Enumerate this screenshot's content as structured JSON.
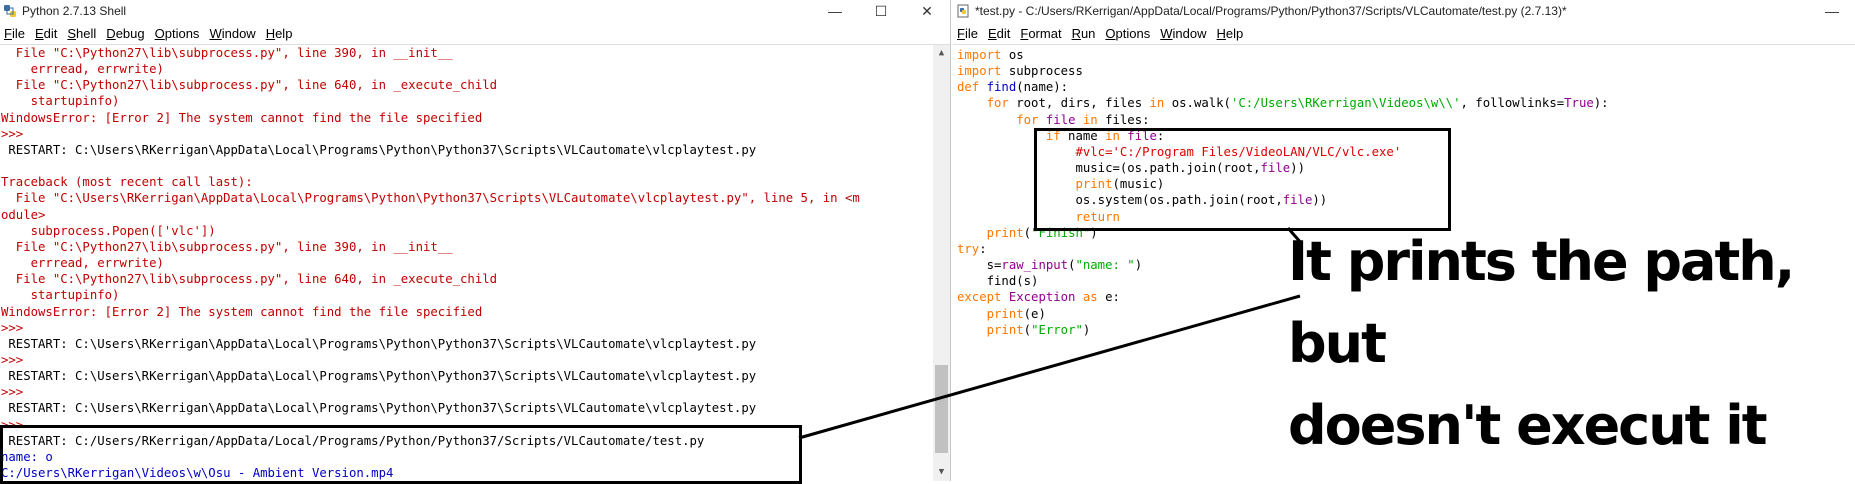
{
  "shell": {
    "title": "Python 2.7.13 Shell",
    "menu": [
      "File",
      "Edit",
      "Shell",
      "Debug",
      "Options",
      "Window",
      "Help"
    ],
    "lines": [
      {
        "t": "  File \"C:\\Python27\\lib\\subprocess.py\", line 390, in __init__",
        "c": "red"
      },
      {
        "t": "    errread, errwrite)",
        "c": "red"
      },
      {
        "t": "  File \"C:\\Python27\\lib\\subprocess.py\", line 640, in _execute_child",
        "c": "red"
      },
      {
        "t": "    startupinfo)",
        "c": "red"
      },
      {
        "t": "WindowsError: [Error 2] The system cannot find the file specified",
        "c": "red"
      },
      {
        "t": ">>> ",
        "c": "red"
      },
      {
        "t": " RESTART: C:\\Users\\RKerrigan\\AppData\\Local\\Programs\\Python\\Python37\\Scripts\\VLCautomate\\vlcplaytest.py",
        "c": "blk"
      },
      {
        "t": "",
        "c": "blk"
      },
      {
        "t": "Traceback (most recent call last):",
        "c": "red"
      },
      {
        "t": "  File \"C:\\Users\\RKerrigan\\AppData\\Local\\Programs\\Python\\Python37\\Scripts\\VLCautomate\\vlcplaytest.py\", line 5, in <m",
        "c": "red"
      },
      {
        "t": "odule>",
        "c": "red"
      },
      {
        "t": "    subprocess.Popen(['vlc'])",
        "c": "red"
      },
      {
        "t": "  File \"C:\\Python27\\lib\\subprocess.py\", line 390, in __init__",
        "c": "red"
      },
      {
        "t": "    errread, errwrite)",
        "c": "red"
      },
      {
        "t": "  File \"C:\\Python27\\lib\\subprocess.py\", line 640, in _execute_child",
        "c": "red"
      },
      {
        "t": "    startupinfo)",
        "c": "red"
      },
      {
        "t": "WindowsError: [Error 2] The system cannot find the file specified",
        "c": "red"
      },
      {
        "t": ">>> ",
        "c": "red"
      },
      {
        "t": " RESTART: C:\\Users\\RKerrigan\\AppData\\Local\\Programs\\Python\\Python37\\Scripts\\VLCautomate\\vlcplaytest.py",
        "c": "blk"
      },
      {
        "t": ">>> ",
        "c": "red"
      },
      {
        "t": " RESTART: C:\\Users\\RKerrigan\\AppData\\Local\\Programs\\Python\\Python37\\Scripts\\VLCautomate\\vlcplaytest.py",
        "c": "blk"
      },
      {
        "t": ">>> ",
        "c": "red"
      },
      {
        "t": " RESTART: C:\\Users\\RKerrigan\\AppData\\Local\\Programs\\Python\\Python37\\Scripts\\VLCautomate\\vlcplaytest.py",
        "c": "blk"
      },
      {
        "t": ">>> ",
        "c": "red"
      },
      {
        "t": " RESTART: C:/Users/RKerrigan/AppData/Local/Programs/Python/Python37/Scripts/VLCautomate/test.py",
        "c": "blk"
      },
      {
        "t": "name: o",
        "c": "blu"
      },
      {
        "t": "C:/Users\\RKerrigan\\Videos\\w\\Osu - Ambient Version.mp4",
        "c": "blu"
      }
    ]
  },
  "editor": {
    "title": "*test.py - C:/Users/RKerrigan/AppData/Local/Programs/Python/Python37/Scripts/VLCautomate/test.py (2.7.13)*",
    "menu": [
      "File",
      "Edit",
      "Format",
      "Run",
      "Options",
      "Window",
      "Help"
    ],
    "lines": [
      [
        {
          "t": "import",
          "c": "kw"
        },
        {
          "t": " os",
          "c": "blk"
        }
      ],
      [
        {
          "t": "import",
          "c": "kw"
        },
        {
          "t": " subprocess",
          "c": "blk"
        }
      ],
      [
        {
          "t": "def",
          "c": "kw"
        },
        {
          "t": " ",
          "c": "blk"
        },
        {
          "t": "find",
          "c": "blu"
        },
        {
          "t": "(name):",
          "c": "blk"
        }
      ],
      [
        {
          "t": "    ",
          "c": "blk"
        },
        {
          "t": "for",
          "c": "kw"
        },
        {
          "t": " root, dirs, files ",
          "c": "blk"
        },
        {
          "t": "in",
          "c": "kw"
        },
        {
          "t": " os.walk(",
          "c": "blk"
        },
        {
          "t": "'C:/Users\\RKerrigan\\Videos\\w\\\\'",
          "c": "str"
        },
        {
          "t": ", followlinks=",
          "c": "blk"
        },
        {
          "t": "True",
          "c": "bi"
        },
        {
          "t": "):",
          "c": "blk"
        }
      ],
      [
        {
          "t": "        ",
          "c": "blk"
        },
        {
          "t": "for",
          "c": "kw"
        },
        {
          "t": " file ",
          "c": "bi"
        },
        {
          "t": "in",
          "c": "kw"
        },
        {
          "t": " files:",
          "c": "blk"
        }
      ],
      [
        {
          "t": "            ",
          "c": "blk"
        },
        {
          "t": "if",
          "c": "kw"
        },
        {
          "t": " name ",
          "c": "blk"
        },
        {
          "t": "in",
          "c": "kw"
        },
        {
          "t": " ",
          "c": "blk"
        },
        {
          "t": "file",
          "c": "bi"
        },
        {
          "t": ":",
          "c": "blk"
        }
      ],
      [
        {
          "t": "                ",
          "c": "blk"
        },
        {
          "t": "#vlc='C:/Program Files/VideoLAN/VLC/vlc.exe'",
          "c": "cmt"
        }
      ],
      [
        {
          "t": "                music=(os.path.join(root,",
          "c": "blk"
        },
        {
          "t": "file",
          "c": "bi"
        },
        {
          "t": "))",
          "c": "blk"
        }
      ],
      [
        {
          "t": "                ",
          "c": "blk"
        },
        {
          "t": "print",
          "c": "kw"
        },
        {
          "t": "(music)",
          "c": "blk"
        }
      ],
      [
        {
          "t": "                os.system(os.path.join(root,",
          "c": "blk"
        },
        {
          "t": "file",
          "c": "bi"
        },
        {
          "t": "))",
          "c": "blk"
        }
      ],
      [
        {
          "t": "                ",
          "c": "blk"
        },
        {
          "t": "return",
          "c": "kw"
        }
      ],
      [
        {
          "t": "    ",
          "c": "blk"
        },
        {
          "t": "print",
          "c": "kw"
        },
        {
          "t": "(",
          "c": "blk"
        },
        {
          "t": "\"Finish\"",
          "c": "str"
        },
        {
          "t": ")",
          "c": "blk"
        }
      ],
      [
        {
          "t": "try",
          "c": "kw"
        },
        {
          "t": ":",
          "c": "blk"
        }
      ],
      [
        {
          "t": "    s=",
          "c": "blk"
        },
        {
          "t": "raw_input",
          "c": "bi"
        },
        {
          "t": "(",
          "c": "blk"
        },
        {
          "t": "\"name: \"",
          "c": "str"
        },
        {
          "t": ")",
          "c": "blk"
        }
      ],
      [
        {
          "t": "    find(s)",
          "c": "blk"
        }
      ],
      [
        {
          "t": "except",
          "c": "kw"
        },
        {
          "t": " ",
          "c": "blk"
        },
        {
          "t": "Exception",
          "c": "bi"
        },
        {
          "t": " ",
          "c": "blk"
        },
        {
          "t": "as",
          "c": "kw"
        },
        {
          "t": " e:",
          "c": "blk"
        }
      ],
      [
        {
          "t": "    ",
          "c": "blk"
        },
        {
          "t": "print",
          "c": "kw"
        },
        {
          "t": "(e)",
          "c": "blk"
        }
      ],
      [
        {
          "t": "    ",
          "c": "blk"
        },
        {
          "t": "print",
          "c": "kw"
        },
        {
          "t": "(",
          "c": "blk"
        },
        {
          "t": "\"Error\"",
          "c": "str"
        },
        {
          "t": ")",
          "c": "blk"
        }
      ]
    ]
  },
  "annotation": {
    "line1": "It prints the path, but",
    "line2": "doesn't execut it"
  },
  "controls": {
    "minimize": "—",
    "maximize": "☐",
    "close": "✕"
  },
  "colors": {
    "error": "#c00000",
    "keyword": "#ff7700",
    "string": "#00aa00",
    "builtin": "#900090",
    "output": "#0000c0"
  }
}
